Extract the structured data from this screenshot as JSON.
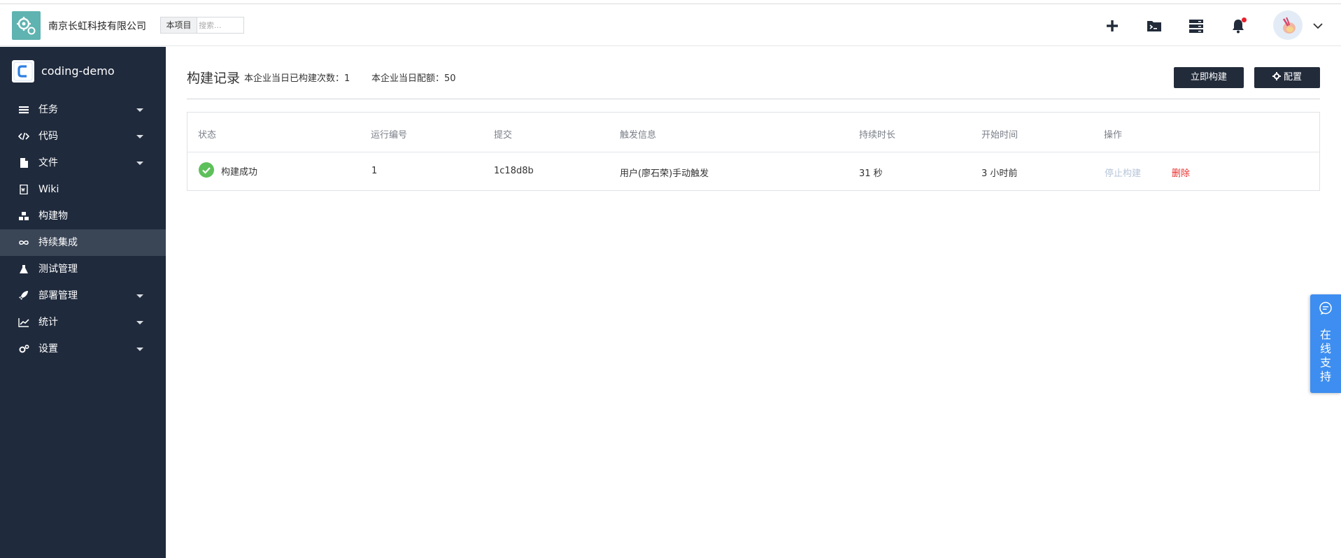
{
  "header": {
    "company": "南京长虹科技有限公司",
    "scope_label": "本项目",
    "search_placeholder": "搜索..."
  },
  "sidebar": {
    "project_name": "coding-demo",
    "items": [
      {
        "label": "任务",
        "icon": "list-icon",
        "expandable": true
      },
      {
        "label": "代码",
        "icon": "code-icon",
        "expandable": true
      },
      {
        "label": "文件",
        "icon": "file-icon",
        "expandable": true
      },
      {
        "label": "Wiki",
        "icon": "wiki-icon",
        "expandable": false
      },
      {
        "label": "构建物",
        "icon": "artifact-icon",
        "expandable": false
      },
      {
        "label": "持续集成",
        "icon": "infinity-icon",
        "expandable": false,
        "active": true
      },
      {
        "label": "测试管理",
        "icon": "flask-icon",
        "expandable": false
      },
      {
        "label": "部署管理",
        "icon": "rocket-icon",
        "expandable": true
      },
      {
        "label": "统计",
        "icon": "chart-icon",
        "expandable": true
      },
      {
        "label": "设置",
        "icon": "gear-icon",
        "expandable": true
      }
    ]
  },
  "main": {
    "title": "构建记录",
    "stat_builds": "本企业当日已构建次数：1",
    "stat_quota": "本企业当日配额：50",
    "build_now_label": "立即构建",
    "config_label": "配置"
  },
  "table": {
    "columns": [
      "状态",
      "运行编号",
      "提交",
      "触发信息",
      "持续时长",
      "开始时间",
      "操作"
    ],
    "rows": [
      {
        "status": "构建成功",
        "run_number": "1",
        "commit": "1c18d8b",
        "trigger": "用户(廖石荣)手动触发",
        "duration": "31 秒",
        "start_time": "3 小时前",
        "action_stop": "停止构建",
        "action_delete": "删除"
      }
    ]
  },
  "support": {
    "label_chars": [
      "在",
      "线",
      "支",
      "持"
    ]
  },
  "colors": {
    "sidebar_bg": "#1f2a3c",
    "sidebar_active": "#3a4556",
    "button_dark": "#222b3a",
    "success": "#5dc05a",
    "danger": "#e8302e",
    "support_blue": "#3d8ef0"
  }
}
